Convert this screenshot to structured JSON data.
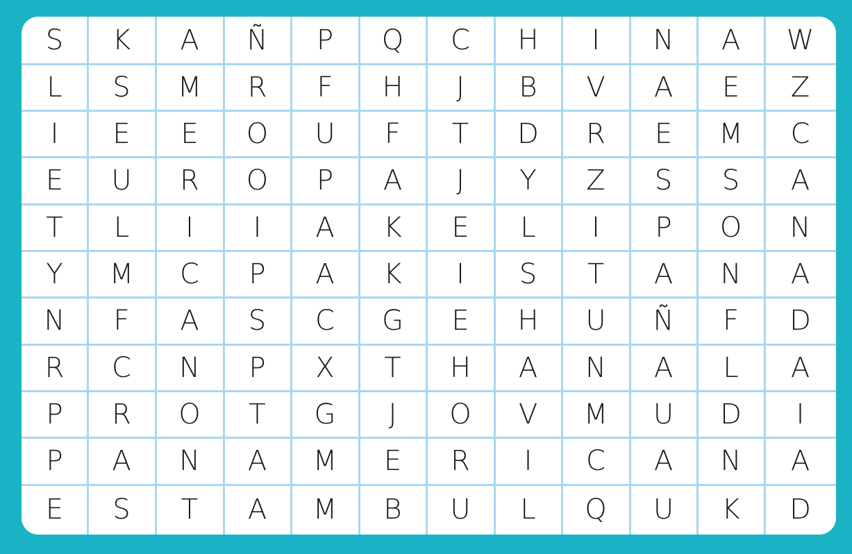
{
  "puzzle": {
    "rows": [
      [
        "S",
        "K",
        "A",
        "Ñ",
        "P",
        "Q",
        "C",
        "H",
        "I",
        "N",
        "A",
        "W"
      ],
      [
        "L",
        "S",
        "M",
        "R",
        "F",
        "H",
        "J",
        "B",
        "V",
        "A",
        "E",
        "Z"
      ],
      [
        "I",
        "E",
        "E",
        "O",
        "U",
        "F",
        "T",
        "D",
        "R",
        "E",
        "M",
        "C"
      ],
      [
        "E",
        "U",
        "R",
        "O",
        "P",
        "A",
        "J",
        "Y",
        "Z",
        "S",
        "S",
        "A"
      ],
      [
        "T",
        "L",
        "I",
        "I",
        "A",
        "K",
        "E",
        "L",
        "I",
        "P",
        "O",
        "N"
      ],
      [
        "Y",
        "M",
        "C",
        "P",
        "A",
        "K",
        "I",
        "S",
        "T",
        "A",
        "N",
        "A"
      ],
      [
        "N",
        "F",
        "A",
        "S",
        "C",
        "G",
        "E",
        "H",
        "U",
        "Ñ",
        "F",
        "D"
      ],
      [
        "R",
        "C",
        "N",
        "P",
        "X",
        "T",
        "H",
        "A",
        "N",
        "A",
        "L",
        "A"
      ],
      [
        "P",
        "R",
        "O",
        "T",
        "G",
        "J",
        "O",
        "V",
        "M",
        "U",
        "D",
        "I"
      ],
      [
        "P",
        "A",
        "N",
        "A",
        "M",
        "E",
        "R",
        "I",
        "C",
        "A",
        "N",
        "A"
      ],
      [
        "E",
        "S",
        "T",
        "A",
        "M",
        "B",
        "U",
        "L",
        "Q",
        "U",
        "K",
        "D"
      ]
    ]
  },
  "colors": {
    "frame": "#1ab3c5",
    "board": "#ffffff",
    "gridline": "#a9d6f2",
    "letter": "#1a1a1a"
  }
}
